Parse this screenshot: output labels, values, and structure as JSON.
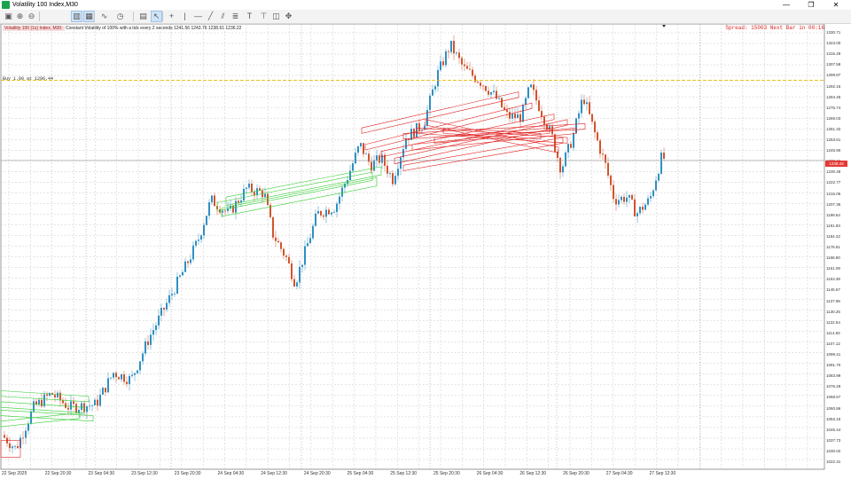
{
  "window": {
    "title": "Volatility 100 Index,M30",
    "minimize": "—",
    "maximize": "❐",
    "close": "✕"
  },
  "toolbar": {
    "items": [
      {
        "name": "new-chart-icon",
        "glyph": "▣",
        "on": false
      },
      {
        "name": "zoom-in-icon",
        "glyph": "⊕",
        "on": false
      },
      {
        "name": "zoom-out-icon",
        "glyph": "⊖",
        "on": false
      },
      {
        "name": "tile-icon",
        "glyph": "▥",
        "on": true
      },
      {
        "name": "chart-grid-icon",
        "glyph": "▦",
        "on": true
      },
      {
        "name": "indicators-icon",
        "glyph": "∿",
        "on": false
      },
      {
        "name": "periods-icon",
        "glyph": "◷",
        "on": false
      },
      {
        "name": "template-icon",
        "glyph": "▤",
        "on": false
      },
      {
        "name": "cursor-icon",
        "glyph": "↖",
        "on": true
      },
      {
        "name": "crosshair-icon",
        "glyph": "+",
        "on": false
      },
      {
        "name": "vertical-line-icon",
        "glyph": "|",
        "on": false
      },
      {
        "name": "horizontal-line-icon",
        "glyph": "—",
        "on": false
      },
      {
        "name": "trendline-icon",
        "glyph": "╱",
        "on": false
      },
      {
        "name": "channel-icon",
        "glyph": "⫽",
        "on": false
      },
      {
        "name": "fibonacci-icon",
        "glyph": "≣",
        "on": false
      },
      {
        "name": "text-icon",
        "glyph": "T",
        "on": false
      },
      {
        "name": "label-icon",
        "glyph": "⊤",
        "on": false
      },
      {
        "name": "shapes-icon",
        "glyph": "◫",
        "on": false
      },
      {
        "name": "arrows-icon",
        "glyph": "✥",
        "on": false
      }
    ]
  },
  "chart": {
    "symbol": "Volatility 100 (1s) Index, M30:",
    "description": "Constant Volatility of 100% with a tick every 2 seconds",
    "ohlc": "1241.56 1243.76 1238.61 1236.22",
    "spread_text": "Spread: 15003 Next Bar in 00:16",
    "level_label": "Buy 1.00 at 1296.44",
    "current_price": "1238.43",
    "colors": {
      "bull": "#2f8fc2",
      "bear": "#d2542c",
      "level": "#e6b800",
      "zone_red": "#e02020",
      "zone_green": "#33cc33",
      "grid": "#c8c8c8"
    },
    "price_axis": [
      "1330.71",
      "1323.00",
      "1315.29",
      "1307.58",
      "1299.87",
      "1292.16",
      "1284.45",
      "1276.74",
      "1269.03",
      "1261.32",
      "1253.61",
      "1245.90",
      "1238.19",
      "1230.48",
      "1222.77",
      "1215.06",
      "1207.35",
      "1199.64",
      "1191.93",
      "1184.22",
      "1176.51",
      "1168.80",
      "1161.09",
      "1153.38",
      "1145.67",
      "1137.96",
      "1130.25",
      "1122.54",
      "1114.83",
      "1107.12",
      "1099.41",
      "1091.70",
      "1083.99",
      "1076.28",
      "1068.57",
      "1060.86",
      "1053.15",
      "1045.44",
      "1037.73",
      "1030.02",
      "1022.31"
    ],
    "time_axis": [
      "22 Sep 2025",
      "22 Sep 20:30",
      "23 Sep 04:30",
      "23 Sep 12:30",
      "23 Sep 20:30",
      "24 Sep 04:30",
      "24 Sep 12:30",
      "24 Sep 20:30",
      "25 Sep 04:30",
      "25 Sep 12:30",
      "25 Sep 20:30",
      "26 Sep 04:30",
      "26 Sep 12:30",
      "26 Sep 20:30",
      "27 Sep 04:30",
      "27 Sep 12:30"
    ]
  }
}
